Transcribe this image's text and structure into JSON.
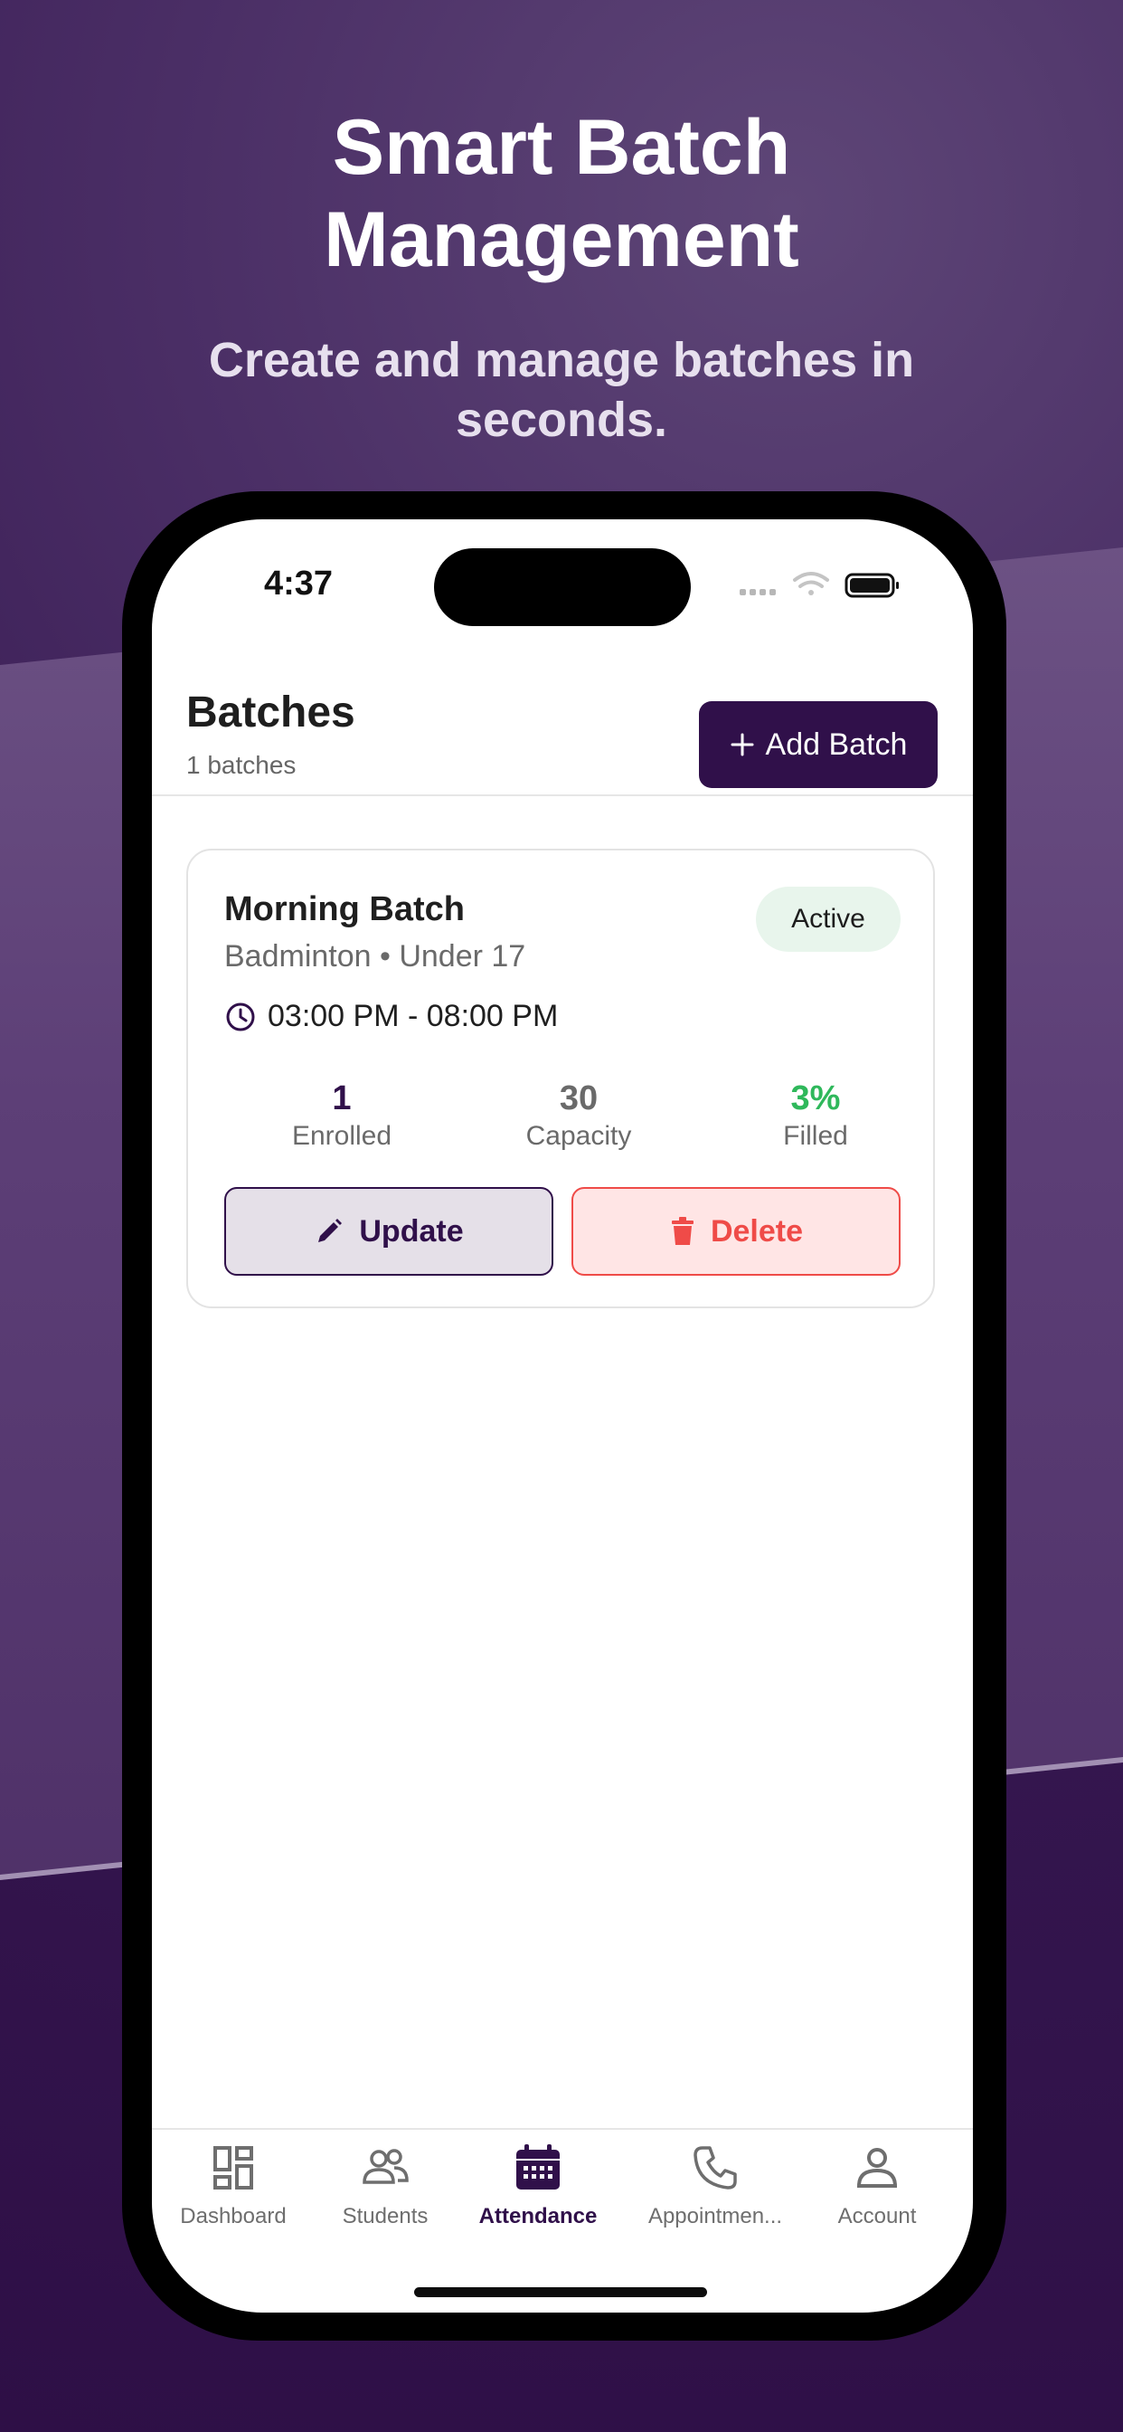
{
  "promo": {
    "title_line1": "Smart Batch",
    "title_line2": "Management",
    "subtitle": "Create and manage batches in seconds."
  },
  "status_bar": {
    "time": "4:37"
  },
  "header": {
    "title": "Batches",
    "count": "1 batches",
    "add_button": "Add Batch"
  },
  "batch": {
    "name": "Morning Batch",
    "subtitle": "Badminton • Under 17",
    "status": "Active",
    "time": "03:00 PM - 08:00 PM",
    "enrolled_value": "1",
    "enrolled_label": "Enrolled",
    "capacity_value": "30",
    "capacity_label": "Capacity",
    "filled_value": "3%",
    "filled_label": "Filled",
    "update_label": "Update",
    "delete_label": "Delete"
  },
  "tabs": [
    {
      "label": "Dashboard",
      "icon": "dashboard-icon"
    },
    {
      "label": "Students",
      "icon": "students-icon"
    },
    {
      "label": "Attendance",
      "icon": "calendar-icon",
      "active": true
    },
    {
      "label": "Appointmen...",
      "icon": "phone-icon"
    },
    {
      "label": "Account",
      "icon": "account-icon"
    }
  ],
  "colors": {
    "brand": "#30104a",
    "active_badge_bg": "#e8f5ec",
    "filled_green": "#2fb85b",
    "delete_red": "#ef4b48"
  }
}
